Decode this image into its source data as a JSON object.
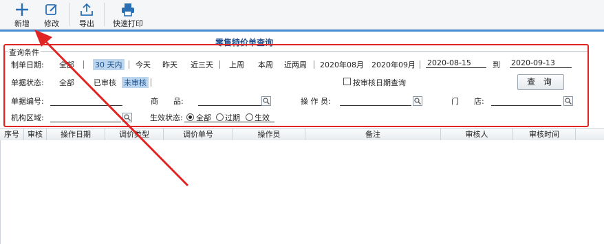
{
  "toolbar": {
    "new_label": "新增",
    "edit_label": "修改",
    "export_label": "导出",
    "print_label": "快速打印"
  },
  "page_title": "零售特价单查询",
  "query": {
    "legend": "查询条件",
    "date_label": "制单日期:",
    "date_options": [
      "全部",
      "30 天内",
      "今天",
      "昨天",
      "近三天",
      "上周",
      "本周",
      "近两周",
      "2020年08月",
      "2020年09月"
    ],
    "date_selected": "30 天内",
    "date_from": "2020-08-15",
    "date_to_label": "到",
    "date_to": "2020-09-13",
    "status_label": "单据状态:",
    "status_options": [
      "全部",
      "已审核",
      "未审核"
    ],
    "status_selected": "未审核",
    "audit_date_checkbox_label": "按审核日期查询",
    "search_button_label": "查 询",
    "doc_no_label": "单据编号:",
    "doc_no_value": "",
    "product_label": "商　　品:",
    "product_value": "",
    "operator_label": "操 作 员:",
    "operator_value": "",
    "store_label": "门　　店:",
    "store_value": "",
    "org_label": "机构区域:",
    "org_value": "",
    "effect_label": "生效状态:",
    "effect_options": [
      "全部",
      "过期",
      "生效"
    ],
    "effect_selected": "全部"
  },
  "grid": {
    "columns": [
      "序号",
      "审核",
      "操作日期",
      "调价类型",
      "调价单号",
      "操作员",
      "备注",
      "审核人",
      "审核时间"
    ],
    "rows": []
  },
  "colors": {
    "accent": "#4a8fd6",
    "annotation": "#e02424",
    "selection": "#bcd5ef"
  },
  "icons": {
    "new": "plus-icon",
    "edit": "edit-icon",
    "export": "export-icon",
    "print": "printer-icon",
    "lookup": "magnifier-icon"
  }
}
